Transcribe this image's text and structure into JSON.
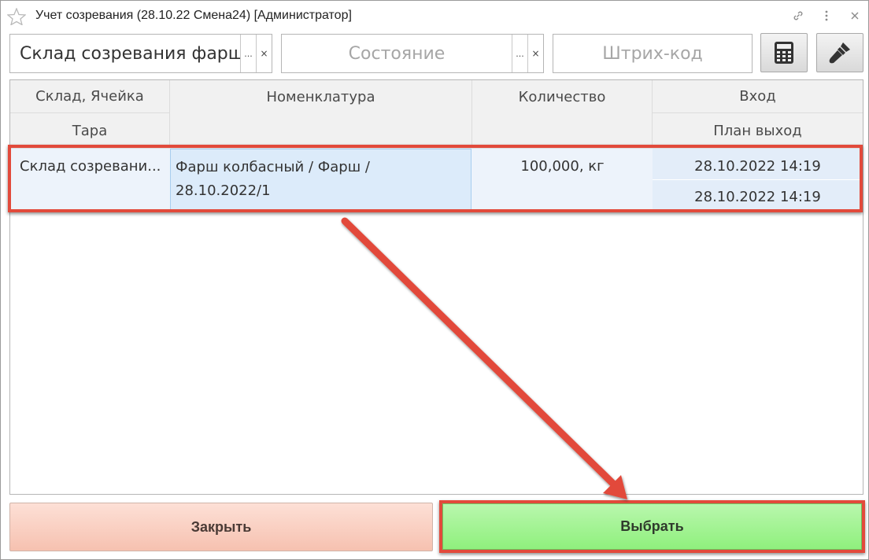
{
  "window": {
    "title": "Учет созревания (28.10.22 Смена24) [Администратор]"
  },
  "toolbar": {
    "warehouse_value": "Склад созревания фарше",
    "warehouse_dots": "...",
    "warehouse_clear": "×",
    "state_placeholder": "Состояние",
    "state_dots": "...",
    "state_clear": "×",
    "barcode_placeholder": "Штрих-код",
    "calculator_icon": "calculator-icon",
    "brush_icon": "brush-icon"
  },
  "table": {
    "headers": {
      "warehouse_cell": "Склад, Ячейка",
      "container": "Тара",
      "nomenclature": "Номенклатура",
      "quantity": "Количество",
      "entry": "Вход",
      "plan_exit": "План выход"
    },
    "rows": [
      {
        "warehouse_cell": "Склад созревани...",
        "nomenclature_line1": "Фарш колбасный / Фарш /",
        "nomenclature_line2": "28.10.2022/1",
        "quantity": "100,000, кг",
        "entry": "28.10.2022 14:19",
        "plan_exit": "28.10.2022 14:19"
      }
    ]
  },
  "buttons": {
    "close_label": "Закрыть",
    "select_label": "Выбрать"
  },
  "colors": {
    "annotation": "#e24a3b",
    "select_button": "#a3f492",
    "close_button": "#fbd3c6",
    "selected_row": "#edf3fb"
  }
}
